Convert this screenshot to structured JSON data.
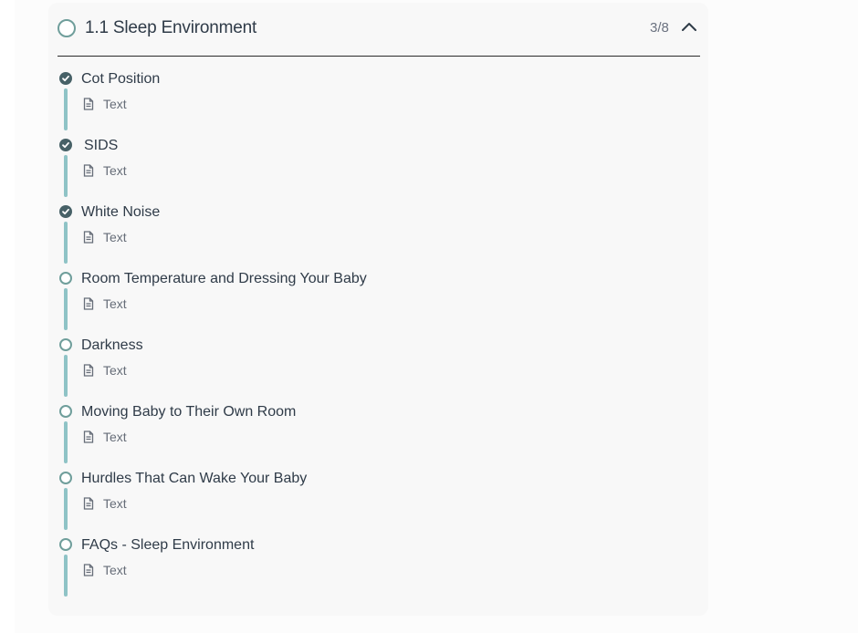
{
  "module": {
    "title": "1.1 Sleep Environment",
    "progress": "3/8",
    "expanded": true,
    "icons": {
      "status": "empty-circle-icon",
      "collapse": "chevron-up-icon"
    }
  },
  "lessons": [
    {
      "title": "Cot Position",
      "completed": true,
      "type_label": "Text",
      "type_icon": "document-icon"
    },
    {
      "title": "SIDS",
      "completed": true,
      "type_label": "Text",
      "type_icon": "document-icon"
    },
    {
      "title": "White Noise",
      "completed": true,
      "type_label": "Text",
      "type_icon": "document-icon"
    },
    {
      "title": "Room Temperature and Dressing Your Baby",
      "completed": false,
      "type_label": "Text",
      "type_icon": "document-icon"
    },
    {
      "title": "Darkness",
      "completed": false,
      "type_label": "Text",
      "type_icon": "document-icon"
    },
    {
      "title": "Moving Baby to Their Own Room",
      "completed": false,
      "type_label": "Text",
      "type_icon": "document-icon"
    },
    {
      "title": "Hurdles That Can Wake Your Baby",
      "completed": false,
      "type_label": "Text",
      "type_icon": "document-icon"
    },
    {
      "title": "FAQs - Sleep Environment",
      "completed": false,
      "type_label": "Text",
      "type_icon": "document-icon"
    }
  ],
  "colors": {
    "accent": "#8fc3c6",
    "completed": "#476167",
    "outline": "#6f9e9b",
    "text": "#2f3b48",
    "muted": "#666d78"
  }
}
